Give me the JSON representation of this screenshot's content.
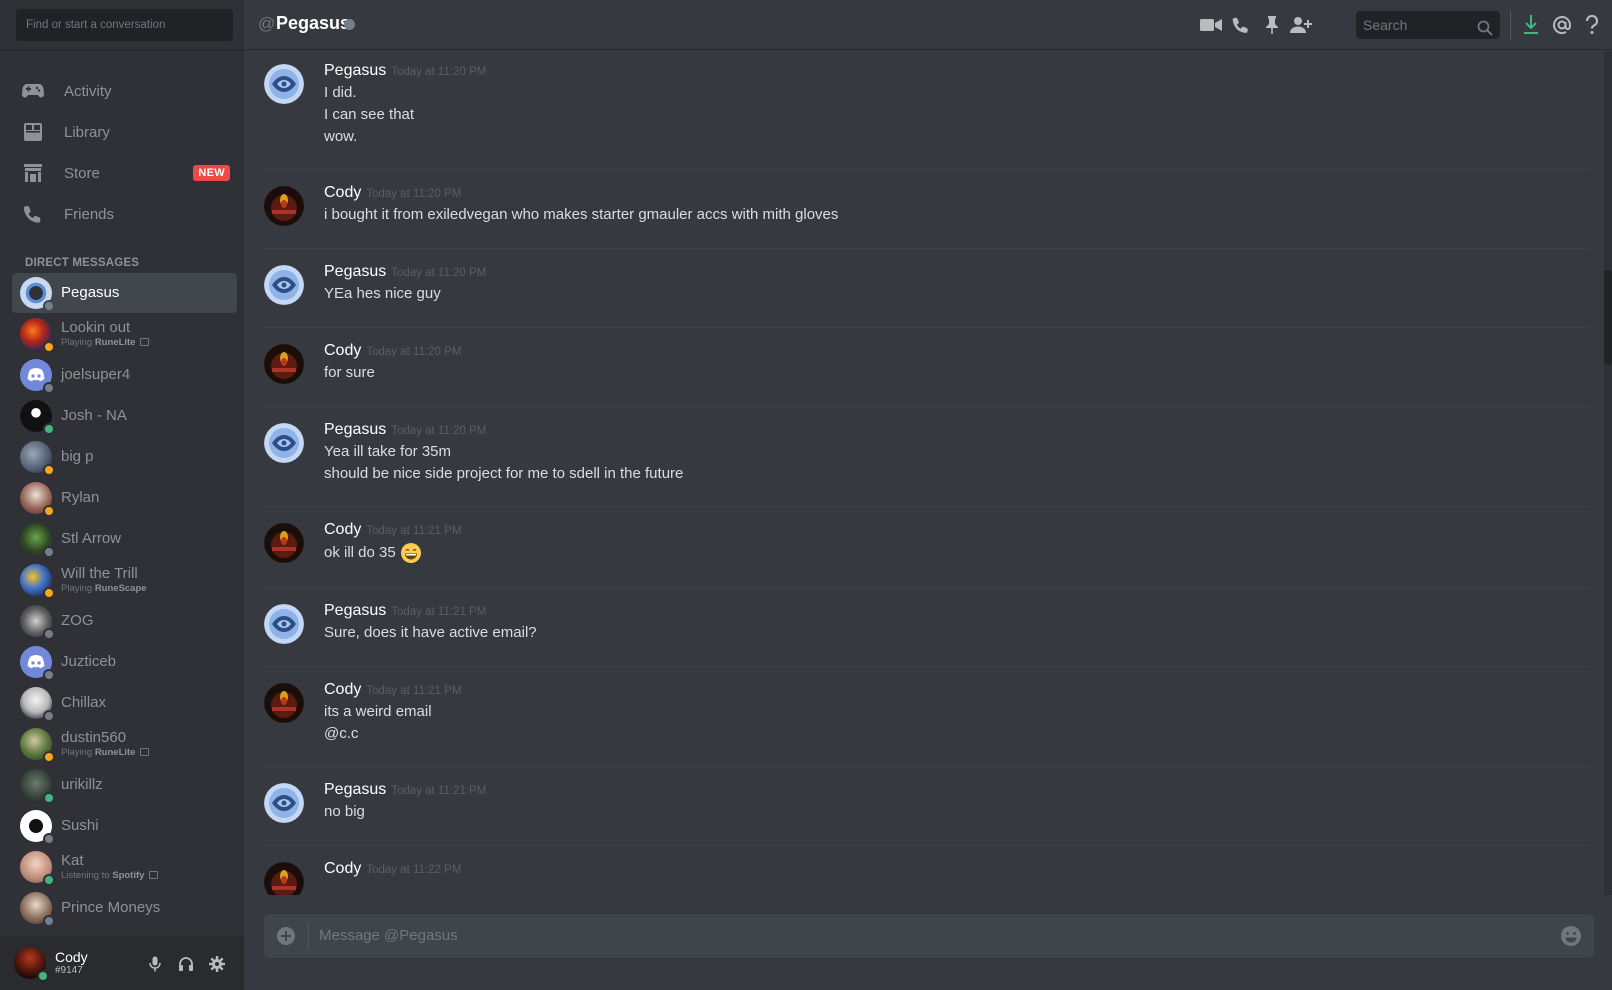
{
  "sidebar": {
    "search_placeholder": "Find or start a conversation",
    "nav": [
      {
        "label": "Activity",
        "icon": "gamepad-icon"
      },
      {
        "label": "Library",
        "icon": "library-icon"
      },
      {
        "label": "Store",
        "icon": "store-icon",
        "badge": "NEW"
      },
      {
        "label": "Friends",
        "icon": "friends-icon"
      }
    ],
    "dm_header": "DIRECT MESSAGES",
    "dms": [
      {
        "name": "Pegasus",
        "status": "offline",
        "active": true
      },
      {
        "name": "Lookin out",
        "sub_prefix": "Playing ",
        "sub_bold": "RuneLite",
        "status": "idle"
      },
      {
        "name": "joelsuper4",
        "status": "offline"
      },
      {
        "name": "Josh - NA",
        "status": "online"
      },
      {
        "name": "big p",
        "status": "idle"
      },
      {
        "name": "Rylan",
        "status": "idle"
      },
      {
        "name": "Stl Arrow",
        "status": "offline"
      },
      {
        "name": "Will the Trill",
        "sub_prefix": "Playing ",
        "sub_bold": "RuneScape",
        "status": "idle"
      },
      {
        "name": "ZOG",
        "status": "offline"
      },
      {
        "name": "Juzticeb",
        "status": "offline"
      },
      {
        "name": "Chillax",
        "status": "offline"
      },
      {
        "name": "dustin560",
        "sub_prefix": "Playing ",
        "sub_bold": "RuneLite",
        "status": "idle"
      },
      {
        "name": "urikillz",
        "status": "online"
      },
      {
        "name": "Sushi",
        "status": "offline"
      },
      {
        "name": "Kat",
        "sub_prefix": "Listening to ",
        "sub_bold": "Spotify",
        "status": "online"
      },
      {
        "name": "Prince Moneys",
        "status": "offline"
      }
    ],
    "user": {
      "name": "Cody",
      "tag": "#9147"
    }
  },
  "header": {
    "at": "@",
    "title": "Pegasus",
    "search_placeholder": "Search"
  },
  "messages": [
    {
      "author": "Pegasus",
      "time": "Today at 11:20 PM",
      "lines": [
        "I did.",
        "I can see that",
        "wow."
      ]
    },
    {
      "author": "Cody",
      "time": "Today at 11:20 PM",
      "lines": [
        "i bought it from exiledvegan who makes starter gmauler accs with mith gloves"
      ]
    },
    {
      "author": "Pegasus",
      "time": "Today at 11:20 PM",
      "lines": [
        "YEa hes nice guy"
      ]
    },
    {
      "author": "Cody",
      "time": "Today at 11:20 PM",
      "lines": [
        "for sure"
      ]
    },
    {
      "author": "Pegasus",
      "time": "Today at 11:20 PM",
      "lines": [
        "Yea ill take for 35m",
        "should be nice side project for me to sdell in the future"
      ]
    },
    {
      "author": "Cody",
      "time": "Today at 11:21 PM",
      "lines": [
        "ok ill do 35"
      ],
      "emoji": "grinning-face-icon"
    },
    {
      "author": "Pegasus",
      "time": "Today at 11:21 PM",
      "lines": [
        "Sure, does it have active email?"
      ]
    },
    {
      "author": "Cody",
      "time": "Today at 11:21 PM",
      "lines": [
        "its a weird email",
        "@c.c"
      ]
    },
    {
      "author": "Pegasus",
      "time": "Today at 11:21 PM",
      "lines": [
        "no big"
      ]
    },
    {
      "author": "Cody",
      "time": "Today at 11:22 PM",
      "lines": []
    }
  ],
  "composer": {
    "placeholder": "Message @Pegasus"
  },
  "colors": {
    "online": "#43b581",
    "idle": "#faa61a",
    "offline": "#747f8d",
    "badge": "#f04747",
    "background": "#36393f",
    "sidebar": "#2f3136"
  }
}
